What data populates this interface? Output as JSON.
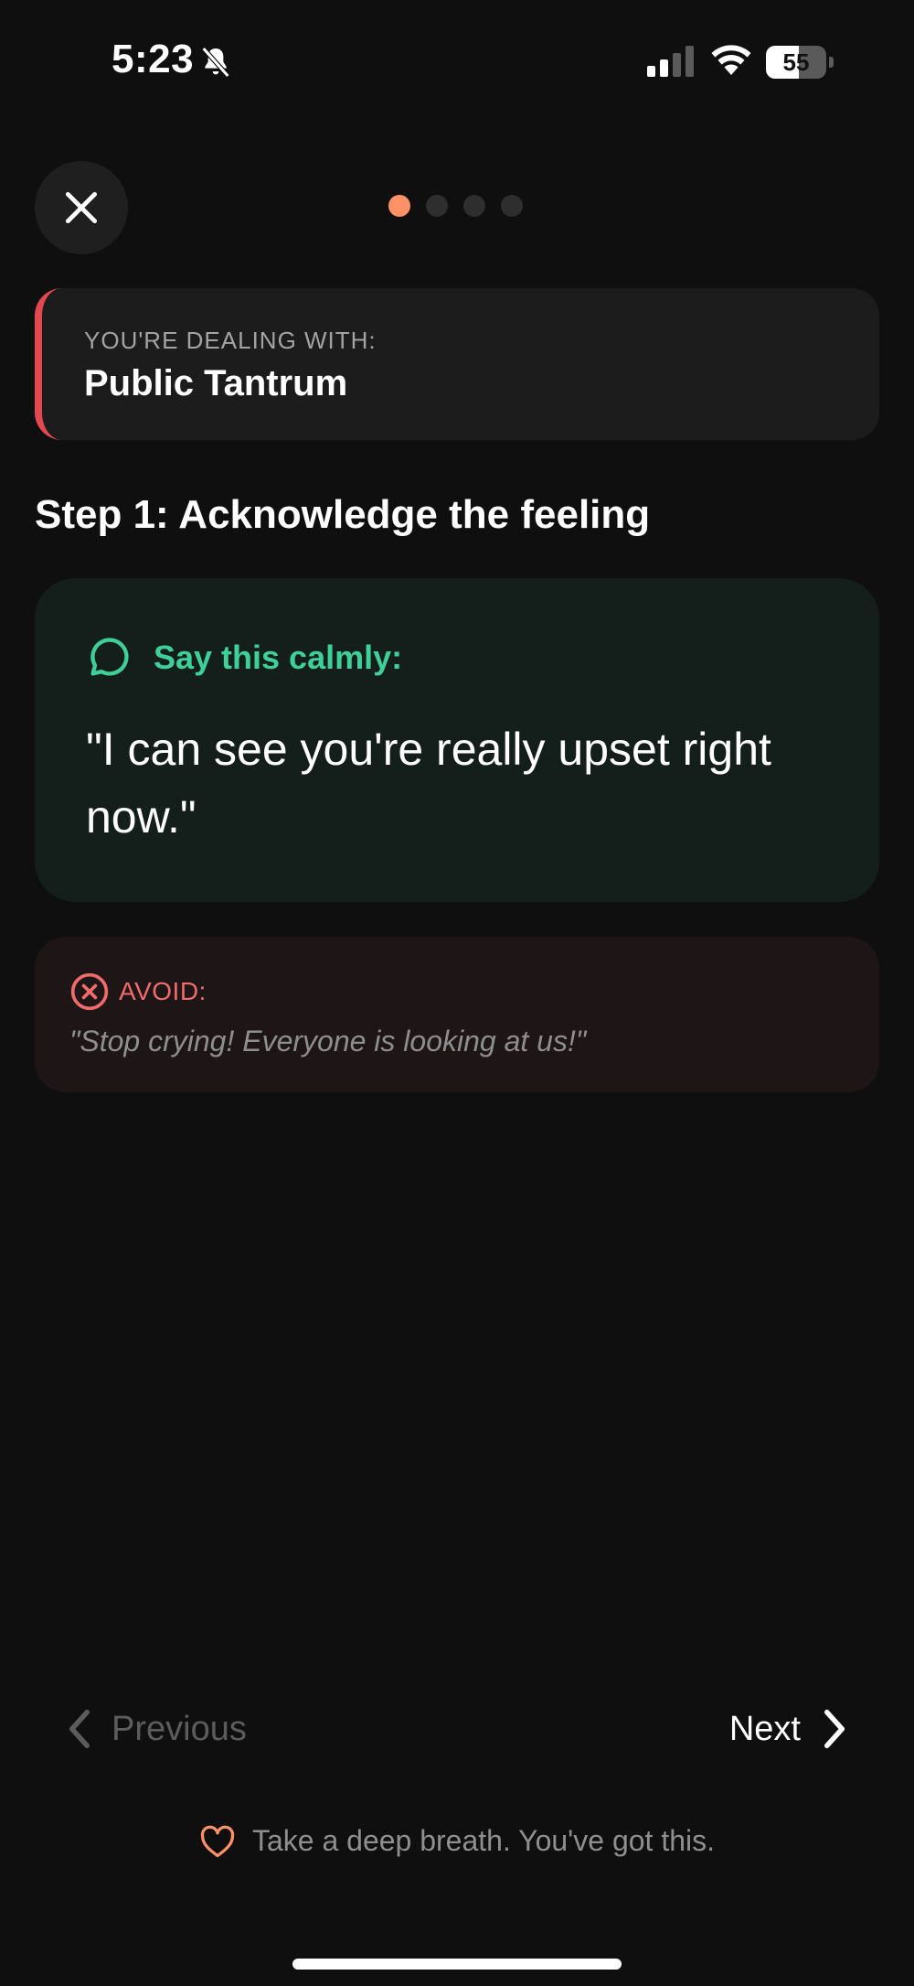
{
  "status_bar": {
    "time": "5:23",
    "battery_level": "55",
    "battery_fraction": 0.55,
    "icons": [
      "bell-off-icon",
      "signal-icon",
      "wifi-icon",
      "battery-icon"
    ]
  },
  "header": {
    "close_icon": "close-icon",
    "steps_total": 4,
    "current_step": 1
  },
  "dealing": {
    "label": "YOU'RE DEALING WITH:",
    "title": "Public Tantrum",
    "accent_color": "#e2484f"
  },
  "step": {
    "title": "Step 1: Acknowledge the feeling"
  },
  "say": {
    "icon": "speech-bubble-icon",
    "label": "Say this calmly:",
    "quote": "\"I can see you're really upset right now.\"",
    "color": "#3ecf9a"
  },
  "avoid": {
    "icon": "x-circle-icon",
    "label": "AVOID:",
    "quote": "\"Stop crying! Everyone is looking at us!\"",
    "color": "#f06b6b"
  },
  "nav": {
    "previous_label": "Previous",
    "next_label": "Next"
  },
  "footer": {
    "icon": "heart-icon",
    "text": "Take a deep breath. You've got this.",
    "accent_color": "#ff9166"
  }
}
